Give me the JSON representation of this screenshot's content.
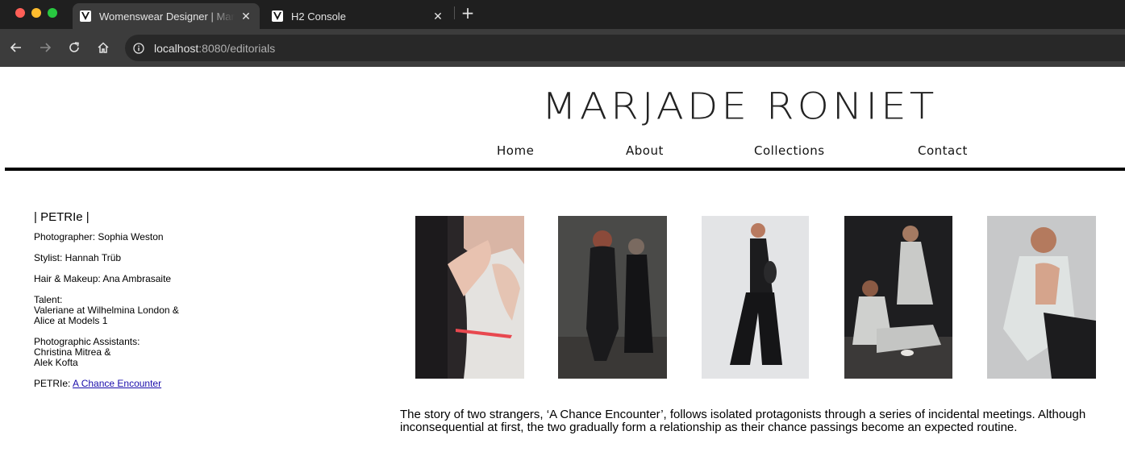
{
  "browser": {
    "tabs": [
      {
        "title": "Womenswear Designer | Marjade Roniet",
        "active": true
      },
      {
        "title": "H2 Console",
        "active": false
      }
    ],
    "new_tab_symbol": "+",
    "url_host": "localhost",
    "url_rest": ":8080/editorials",
    "icons": {
      "back": "back-arrow-icon",
      "forward": "forward-arrow-icon",
      "reload": "reload-icon",
      "home": "home-icon",
      "site_info": "info-icon",
      "close": "close-icon"
    }
  },
  "site": {
    "logo": "MARJADE RONIET",
    "nav": [
      "Home",
      "About",
      "Collections",
      "Contact"
    ]
  },
  "editorial": {
    "heading": "| PETRIe |",
    "credits": [
      {
        "lines": [
          "Photographer: Sophia Weston"
        ]
      },
      {
        "lines": [
          "Stylist: Hannah Trüb"
        ]
      },
      {
        "lines": [
          "Hair & Makeup: Ana Ambrasaite"
        ]
      },
      {
        "lines": [
          "Talent:",
          "Valeriane at Wilhelmina London &",
          "Alice at Models 1"
        ]
      },
      {
        "lines": [
          "Photographic Assistants:",
          "Christina Mitrea &",
          "Alek Kofta"
        ]
      }
    ],
    "petrie_label": "PETRIe: ",
    "petrie_link": "A Chance Encounter",
    "story": "The story of two strangers, ‘A Chance Encounter’, follows isolated protagonists through a series of incidental meetings. Although inconsequential at first, the two gradually form a relationship as their chance passings become an expected routine."
  },
  "colors": {
    "tabbar": "#1f1f1f",
    "toolbar": "#3c3c3c",
    "link": "#1a0dab"
  }
}
